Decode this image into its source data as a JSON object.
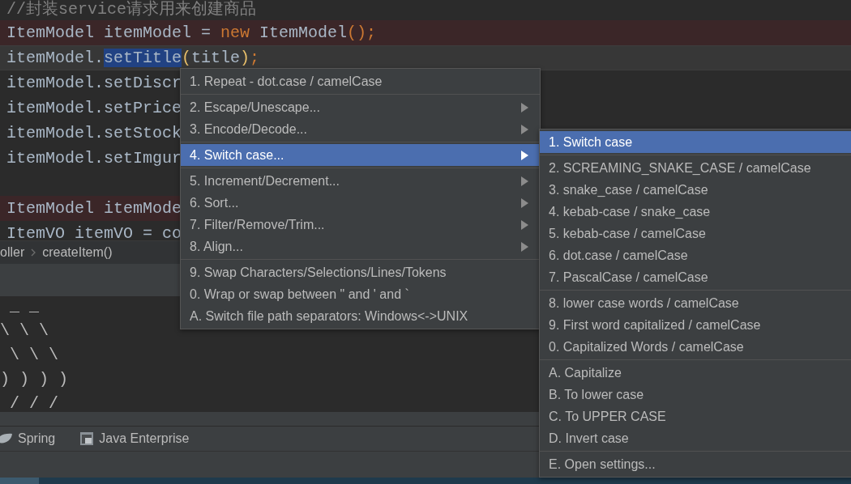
{
  "editor": {
    "lines": [
      {
        "error": false,
        "current": false,
        "tokens": [
          {
            "text": "//封装service请求用来创建商品",
            "kind": "comment"
          }
        ]
      },
      {
        "error": true,
        "current": false,
        "tokens": [
          {
            "text": "ItemModel itemModel = ",
            "kind": "plain"
          },
          {
            "text": "new",
            "kind": "keyword"
          },
          {
            "text": " ItemModel",
            "kind": "plain"
          },
          {
            "text": "();",
            "kind": "keyword"
          }
        ]
      },
      {
        "error": false,
        "current": true,
        "tokens": [
          {
            "text": "itemModel.",
            "kind": "plain"
          },
          {
            "text": "setTitle",
            "kind": "selected"
          },
          {
            "text": "(",
            "kind": "paren"
          },
          {
            "text": "title",
            "kind": "plain"
          },
          {
            "text": ")",
            "kind": "paren"
          },
          {
            "text": ";",
            "kind": "keyword"
          }
        ]
      },
      {
        "error": false,
        "current": false,
        "tokens": [
          {
            "text": "itemModel.setDiscr",
            "kind": "plain"
          }
        ]
      },
      {
        "error": false,
        "current": false,
        "tokens": [
          {
            "text": "itemModel.setPrice",
            "kind": "plain"
          }
        ]
      },
      {
        "error": false,
        "current": false,
        "tokens": [
          {
            "text": "itemModel.setStock",
            "kind": "plain"
          }
        ]
      },
      {
        "error": false,
        "current": false,
        "tokens": [
          {
            "text": "itemModel.setImgur",
            "kind": "plain"
          }
        ]
      },
      {
        "error": false,
        "current": false
      },
      {
        "error": true,
        "current": false,
        "tokens": [
          {
            "text": "ItemModel itemMode",
            "kind": "plain"
          }
        ]
      },
      {
        "error": false,
        "current": false,
        "tokens": [
          {
            "text": "ItemVO itemVO = co",
            "kind": "plain"
          }
        ]
      }
    ]
  },
  "breadcrumb": [
    "oller",
    "createItem()"
  ],
  "console": {
    "lines": [
      " _ _",
      "\\ \\ \\",
      " \\ \\ \\",
      ") ) ) )",
      " / / /"
    ]
  },
  "tool_windows": [
    {
      "label": "Spring",
      "kind": "spring"
    },
    {
      "label": "Java Enterprise",
      "kind": "javaee"
    }
  ],
  "menu": {
    "groups": [
      [
        {
          "label": "1. Repeat - dot.case / camelCase",
          "submenu": false,
          "selected": false
        }
      ],
      [
        {
          "label": "2. Escape/Unescape...",
          "submenu": true,
          "selected": false
        },
        {
          "label": "3. Encode/Decode...",
          "submenu": true,
          "selected": false
        }
      ],
      [
        {
          "label": "4. Switch case...",
          "submenu": true,
          "selected": true
        }
      ],
      [
        {
          "label": "5. Increment/Decrement...",
          "submenu": true,
          "selected": false
        },
        {
          "label": "6. Sort...",
          "submenu": true,
          "selected": false
        },
        {
          "label": "7. Filter/Remove/Trim...",
          "submenu": true,
          "selected": false
        },
        {
          "label": "8. Align...",
          "submenu": true,
          "selected": false
        }
      ],
      [
        {
          "label": "9. Swap Characters/Selections/Lines/Tokens",
          "submenu": false,
          "selected": false
        },
        {
          "label": "0. Wrap or swap between \" and ' and `",
          "submenu": false,
          "selected": false
        },
        {
          "label": "A. Switch file path separators: Windows<->UNIX",
          "submenu": false,
          "selected": false
        }
      ]
    ]
  },
  "submenu": {
    "groups": [
      [
        {
          "label": "1. Switch case",
          "submenu": false,
          "selected": true
        }
      ],
      [
        {
          "label": "2. SCREAMING_SNAKE_CASE / camelCase",
          "submenu": false,
          "selected": false
        },
        {
          "label": "3. snake_case / camelCase",
          "submenu": false,
          "selected": false
        },
        {
          "label": "4. kebab-case / snake_case",
          "submenu": false,
          "selected": false
        },
        {
          "label": "5. kebab-case / camelCase",
          "submenu": false,
          "selected": false
        },
        {
          "label": "6. dot.case / camelCase",
          "submenu": false,
          "selected": false
        },
        {
          "label": "7. PascalCase / camelCase",
          "submenu": false,
          "selected": false
        }
      ],
      [
        {
          "label": "8. lower case words / camelCase",
          "submenu": false,
          "selected": false
        },
        {
          "label": "9. First word capitalized / camelCase",
          "submenu": false,
          "selected": false
        },
        {
          "label": "0. Capitalized Words / camelCase",
          "submenu": false,
          "selected": false
        }
      ],
      [
        {
          "label": "A. Capitalize",
          "submenu": false,
          "selected": false
        },
        {
          "label": "B. To lower case",
          "submenu": false,
          "selected": false
        },
        {
          "label": "C. To UPPER CASE",
          "submenu": false,
          "selected": false
        },
        {
          "label": "D. Invert case",
          "submenu": false,
          "selected": false
        }
      ],
      [
        {
          "label": "E. Open settings...",
          "submenu": false,
          "selected": false
        }
      ]
    ]
  }
}
